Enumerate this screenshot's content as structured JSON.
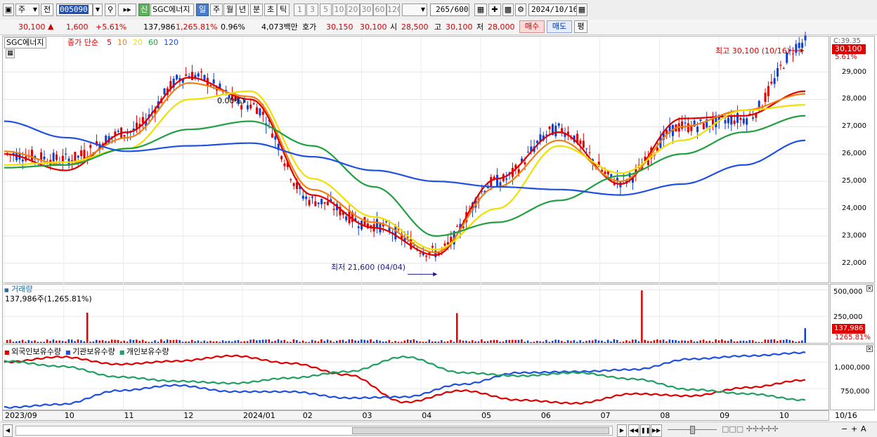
{
  "toolbar": {
    "period_label": "주",
    "prev_label": "전",
    "code": "005090",
    "name_badge": "신",
    "name": "SGC에너지",
    "period_tabs": [
      "일",
      "주",
      "월",
      "년",
      "분",
      "초",
      "틱"
    ],
    "intervals": [
      "1",
      "3",
      "5",
      "10",
      "20",
      "30",
      "60",
      "120"
    ],
    "count": "265",
    "count_total": "/600",
    "date": "2024/10/16"
  },
  "quote": {
    "price": "30,100",
    "change": "1,600",
    "change_pct": "+5.61%",
    "volume": "137,986",
    "vol_ratio": "1,265.81%",
    "turnover_pct": "0.96%",
    "amount": "4,073백만",
    "bid_label": "호가",
    "bid1": "30,150",
    "bid2": "30,100",
    "open_label": "시",
    "open": "28,500",
    "high_label": "고",
    "high": "30,100",
    "low_label": "저",
    "low": "28,000",
    "buy_label": "매수",
    "sell_label": "매도",
    "flat_label": "평"
  },
  "legend": {
    "name": "SGC에너지",
    "series_prefix": "종가 단순",
    "mas": [
      {
        "period": "5",
        "color": "#e00000"
      },
      {
        "period": "10",
        "color": "#f08010"
      },
      {
        "period": "20",
        "color": "#f0e000"
      },
      {
        "period": "60",
        "color": "#20a040"
      },
      {
        "period": "120",
        "color": "#2050e0"
      }
    ]
  },
  "annotations": {
    "high_text": "최고 30,100 (10/16)",
    "low_text": "최저 21,600 (04/04)",
    "mid_text": "0.00%)",
    "axis_top_label": "C:39.35",
    "last_price_tag": "30,100",
    "last_pct": "5.61%"
  },
  "volume_panel": {
    "title": "거래량",
    "info": "137,986주(1,265.81%)",
    "last_tag": "137,986",
    "last_pct": "1265.81%",
    "ticks": [
      "500,000",
      "250,000"
    ]
  },
  "holdings_panel": {
    "legend": [
      "외국인보유수량",
      "기관보유수량",
      "개인보유수량"
    ],
    "colors": [
      "#e00000",
      "#2050e0",
      "#20a060"
    ],
    "ticks": [
      "1,000,000",
      "750,000"
    ]
  },
  "x_axis": {
    "labels": [
      "2023/09",
      "10",
      "11",
      "12",
      "2024/01",
      "02",
      "03",
      "04",
      "05",
      "06",
      "07",
      "08",
      "09",
      "10"
    ],
    "last_date": "10/16"
  },
  "chart_data": {
    "type": "candlestick",
    "title": "SGC에너지",
    "x_range": [
      "2023/09",
      "2024/10/16"
    ],
    "y_ticks": [
      29000,
      28000,
      27000,
      26000,
      25000,
      24000,
      23000,
      22000
    ],
    "ylim": [
      21300,
      30300
    ],
    "high": {
      "value": 30100,
      "date": "10/16"
    },
    "low": {
      "value": 21600,
      "date": "04/04"
    },
    "x": [
      "2023/09",
      "2023/10",
      "2023/11",
      "2023/12",
      "2024/01",
      "2024/02",
      "2024/03",
      "2024/04",
      "2024/05",
      "2024/06",
      "2024/07",
      "2024/08",
      "2024/09",
      "2024/10"
    ],
    "close": [
      26000,
      25800,
      26800,
      28900,
      27800,
      24300,
      23400,
      22400,
      25000,
      26900,
      25000,
      27000,
      27300,
      30100
    ],
    "moving_averages": [
      {
        "name": "5",
        "color": "#e00000",
        "values": [
          26000,
          25400,
          26800,
          28800,
          28000,
          24500,
          23300,
          22300,
          25100,
          26800,
          24900,
          27300,
          27400,
          28300
        ]
      },
      {
        "name": "10",
        "color": "#f08010",
        "values": [
          26100,
          25600,
          26600,
          28600,
          28100,
          24700,
          23500,
          22400,
          24800,
          26500,
          25000,
          27000,
          27600,
          28200
        ]
      },
      {
        "name": "20",
        "color": "#f0e000",
        "values": [
          25600,
          25700,
          26200,
          28000,
          28300,
          25100,
          23700,
          22500,
          24000,
          26300,
          25300,
          26500,
          27600,
          27800
        ]
      },
      {
        "name": "60",
        "color": "#20a040",
        "values": [
          25500,
          25600,
          26200,
          26900,
          27200,
          26300,
          24800,
          23000,
          23500,
          24300,
          25200,
          26000,
          26800,
          27400
        ]
      },
      {
        "name": "120",
        "color": "#2050e0",
        "values": [
          27200,
          26600,
          26100,
          26300,
          26400,
          25900,
          25400,
          25000,
          24800,
          24700,
          24500,
          24900,
          25600,
          26500
        ]
      }
    ],
    "volume": {
      "ylim": [
        0,
        550000
      ],
      "ticks": [
        500000,
        250000
      ],
      "spikes": [
        {
          "date": "2023/10",
          "value": 285000
        },
        {
          "date": "2024/04",
          "value": 280000
        },
        {
          "date": "2024/07",
          "value": 495000
        },
        {
          "date": "2024/10/16",
          "value": 137986
        }
      ]
    },
    "holdings": {
      "ylim": [
        550000,
        1150000
      ],
      "ticks": [
        1000000,
        750000
      ],
      "series": [
        {
          "name": "외국인보유수량",
          "color": "#e00000",
          "values": [
            1000000,
            1050000,
            980000,
            1010000,
            1060000,
            990000,
            880000,
            620000,
            730000,
            640000,
            610000,
            700000,
            680000,
            760000,
            830000
          ]
        },
        {
          "name": "기관보유수량",
          "color": "#2050e0",
          "values": [
            570000,
            600000,
            730000,
            780000,
            720000,
            720000,
            660000,
            670000,
            790000,
            900000,
            910000,
            930000,
            1030000,
            1060000,
            1090000
          ]
        },
        {
          "name": "개인보유수량",
          "color": "#20a060",
          "values": [
            1010000,
            960000,
            860000,
            820000,
            800000,
            850000,
            910000,
            1050000,
            900000,
            870000,
            900000,
            840000,
            740000,
            700000,
            640000
          ]
        }
      ]
    }
  }
}
